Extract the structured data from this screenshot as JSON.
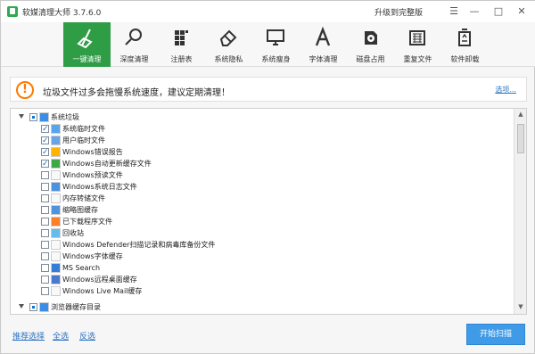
{
  "window": {
    "title": "软媒清理大师 3.7.6.0",
    "upgrade_label": "升级到完整版",
    "minimize_icon": "minimize-icon",
    "maximize_icon": "maximize-icon",
    "close_icon": "close-icon"
  },
  "toolbar": {
    "items": [
      {
        "label": "一键清理",
        "icon": "broom-icon",
        "active": true
      },
      {
        "label": "深度清理",
        "icon": "magnifier-icon",
        "active": false
      },
      {
        "label": "注册表",
        "icon": "registry-icon",
        "active": false
      },
      {
        "label": "系统隐私",
        "icon": "eraser-icon",
        "active": false
      },
      {
        "label": "系统瘦身",
        "icon": "monitor-icon",
        "active": false
      },
      {
        "label": "字体清理",
        "icon": "font-icon",
        "active": false
      },
      {
        "label": "磁盘占用",
        "icon": "disk-icon",
        "active": false
      },
      {
        "label": "重复文件",
        "icon": "duplicate-files-icon",
        "active": false
      },
      {
        "label": "软件卸载",
        "icon": "recycle-icon",
        "active": false
      }
    ],
    "accent_color": "#2f9c46"
  },
  "notice": {
    "text": "垃圾文件过多会拖慢系统速度，建议定期清理！",
    "options_label": "选项..."
  },
  "tree": {
    "rows": [
      {
        "label": "系统垃圾",
        "level": 0,
        "checked": "partial",
        "icon": "windows-icon"
      },
      {
        "label": "系统临时文件",
        "level": 1,
        "checked": "checked",
        "icon": "windows-icon"
      },
      {
        "label": "用户临时文件",
        "level": 1,
        "checked": "checked",
        "icon": "user-icon"
      },
      {
        "label": "Windows错误报告",
        "level": 1,
        "checked": "checked",
        "icon": "warning-icon"
      },
      {
        "label": "Windows自动更新缓存文件",
        "level": 1,
        "checked": "checked",
        "icon": "update-icon"
      },
      {
        "label": "Windows预读文件",
        "level": 1,
        "checked": "unchecked",
        "icon": "prefetch-icon"
      },
      {
        "label": "Windows系统日志文件",
        "level": 1,
        "checked": "unchecked",
        "icon": "log-icon"
      },
      {
        "label": "内存转储文件",
        "level": 1,
        "checked": "unchecked",
        "icon": "memory-icon"
      },
      {
        "label": "缩略图缓存",
        "level": 1,
        "checked": "unchecked",
        "icon": "image-icon"
      },
      {
        "label": "已下载程序文件",
        "level": 1,
        "checked": "unchecked",
        "icon": "download-icon"
      },
      {
        "label": "回收站",
        "level": 1,
        "checked": "unchecked",
        "icon": "recycle-bin-icon"
      },
      {
        "label": "Windows Defender扫描记录和病毒库备份文件",
        "level": 1,
        "checked": "unchecked",
        "icon": "shield-icon"
      },
      {
        "label": "Windows字体缓存",
        "level": 1,
        "checked": "unchecked",
        "icon": "font-cache-icon"
      },
      {
        "label": "MS Search",
        "level": 1,
        "checked": "unchecked",
        "icon": "search-icon"
      },
      {
        "label": "Windows远程桌面缓存",
        "level": 1,
        "checked": "unchecked",
        "icon": "remote-desktop-icon"
      },
      {
        "label": "Windows Live Mail缓存",
        "level": 1,
        "checked": "unchecked",
        "icon": "mail-icon"
      },
      {
        "label": "浏览器缓存目录",
        "level": 0,
        "checked": "partial",
        "icon": "browser-icon"
      }
    ]
  },
  "footer": {
    "recommended_label": "推荐选择",
    "select_all_label": "全选",
    "invert_label": "反选",
    "start_scan_label": "开始扫描"
  }
}
